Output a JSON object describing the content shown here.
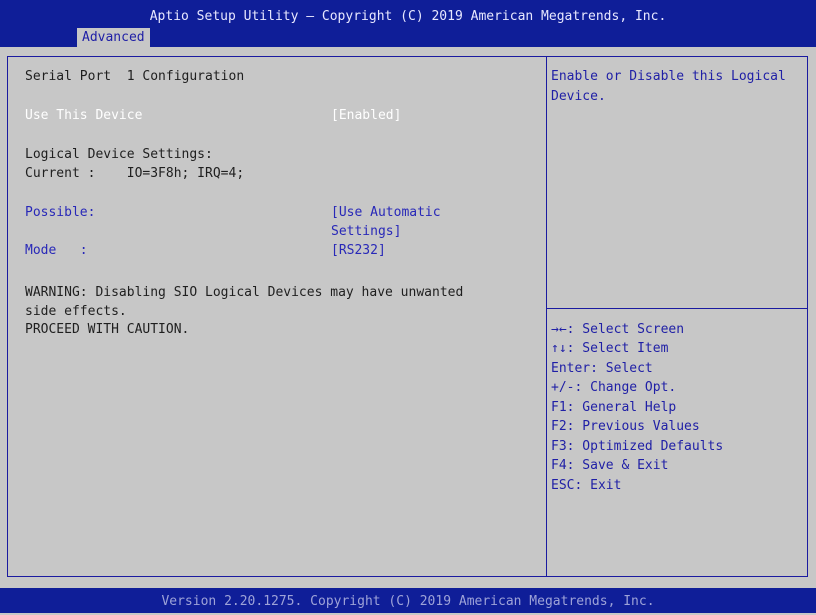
{
  "header": {
    "title": "Aptio Setup Utility – Copyright (C) 2019 American Megatrends, Inc.",
    "active_tab": "Advanced"
  },
  "main": {
    "heading": "Serial Port  1 Configuration",
    "use_device": {
      "label": "Use This Device",
      "value": "[Enabled]"
    },
    "logical_heading": "Logical Device Settings:",
    "current": "Current :    IO=3F8h; IRQ=4;",
    "possible": {
      "label": "Possible:",
      "value_line1": "[Use Automatic",
      "value_line2": "Settings]"
    },
    "mode": {
      "label": "Mode   :",
      "value": "[RS232]"
    },
    "warning_line1": "WARNING: Disabling SIO Logical Devices may have unwanted",
    "warning_line2": "side effects.",
    "warning_line3": "PROCEED WITH CAUTION."
  },
  "help": {
    "description_line1": "Enable or Disable this Logical",
    "description_line2": "Device.",
    "keys": [
      "→←: Select Screen",
      "↑↓: Select Item",
      "Enter: Select",
      "+/-: Change Opt.",
      "F1: General Help",
      "F2: Previous Values",
      "F3: Optimized Defaults",
      "F4: Save & Exit",
      "ESC: Exit"
    ]
  },
  "footer": {
    "version": "Version 2.20.1275. Copyright (C) 2019 American Megatrends, Inc."
  },
  "colors": {
    "header_bg": "#0f1e98",
    "body_bg": "#c7c7c7",
    "selected_text": "#ffffff",
    "option_text": "#2828b8"
  }
}
